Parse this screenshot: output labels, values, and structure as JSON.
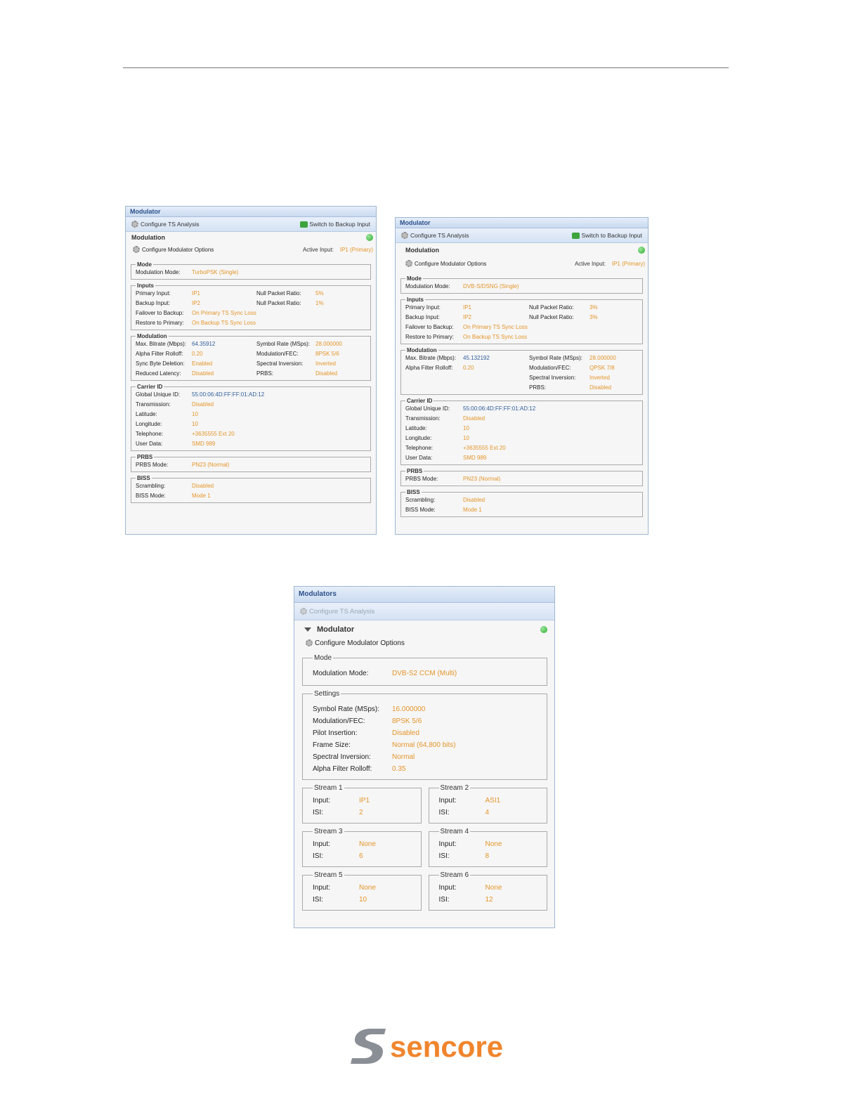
{
  "panel_single_turbo": {
    "title": "Modulator",
    "toolbar_left": "Configure TS Analysis",
    "toolbar_right": "Switch to Backup Input",
    "section": "Modulation",
    "config_options": "Configure Modulator Options",
    "active_input_label": "Active Input:",
    "active_input_value": "IP1 (Primary)",
    "mode_legend": "Mode",
    "mode_label": "Modulation Mode:",
    "mode_value": "TurboPSK (Single)",
    "inputs_legend": "Inputs",
    "primary_input_label": "Primary Input:",
    "primary_input_value": "IP1",
    "null1_label": "Null Packet Ratio:",
    "null1_value": "5%",
    "backup_input_label": "Backup Input:",
    "backup_input_value": "IP2",
    "null2_label": "Null Packet Ratio:",
    "null2_value": "1%",
    "failover_label": "Failover to Backup:",
    "failover_value": "On Primary TS Sync Loss",
    "restore_label": "Restore to Primary:",
    "restore_value": "On Backup TS Sync Loss",
    "modulation_legend": "Modulation",
    "max_bitrate_label": "Max. Bitrate (Mbps):",
    "max_bitrate_value": "64.35912",
    "symbol_rate_label": "Symbol Rate (MSps):",
    "symbol_rate_value": "28.000000",
    "alpha_label": "Alpha Filter Rolloff:",
    "alpha_value": "0.20",
    "modfec_label": "Modulation/FEC:",
    "modfec_value": "8PSK 5/6",
    "sync_label": "Sync Byte Deletion:",
    "sync_value": "Enabled",
    "spectral_label": "Spectral Inversion:",
    "spectral_value": "Inverted",
    "latency_label": "Reduced Latency:",
    "latency_value": "Disabled",
    "prbs_label": "PRBS:",
    "prbs_value": "Disabled",
    "carrier_legend": "Carrier ID",
    "guid_label": "Global Unique ID:",
    "guid_value": "55:00:06:4D:FF:FF:01:AD:12",
    "transmission_label": "Transmission:",
    "transmission_value": "Disabled",
    "latitude_label": "Latitude:",
    "latitude_value": "10",
    "longitude_label": "Longitude:",
    "longitude_value": "10",
    "telephone_label": "Telephone:",
    "telephone_value": "+3635555 Ext 20",
    "userdata_label": "User Data:",
    "userdata_value": "SMD 989",
    "prbs_legend": "PRBS",
    "prbs_mode_label": "PRBS Mode:",
    "prbs_mode_value": "PN23 (Normal)",
    "biss_legend": "BISS",
    "scrambling_label": "Scrambling:",
    "scrambling_value": "Disabled",
    "biss_mode_label": "BISS Mode:",
    "biss_mode_value": "Mode 1"
  },
  "panel_single_dvbs": {
    "title": "Modulator",
    "toolbar_left": "Configure TS Analysis",
    "toolbar_right": "Switch to Backup Input",
    "section": "Modulation",
    "config_options": "Configure Modulator Options",
    "active_input_label": "Active Input:",
    "active_input_value": "IP1 (Primary)",
    "mode_legend": "Mode",
    "mode_label": "Modulation Mode:",
    "mode_value": "DVB-S/DSNG (Single)",
    "inputs_legend": "Inputs",
    "primary_input_label": "Primary Input:",
    "primary_input_value": "IP1",
    "null1_label": "Null Packet Ratio:",
    "null1_value": "3%",
    "backup_input_label": "Backup Input:",
    "backup_input_value": "IP2",
    "null2_label": "Null Packet Ratio:",
    "null2_value": "3%",
    "failover_label": "Failover to Backup:",
    "failover_value": "On Primary TS Sync Loss",
    "restore_label": "Restore to Primary:",
    "restore_value": "On Backup TS Sync Loss",
    "modulation_legend": "Modulation",
    "max_bitrate_label": "Max. Bitrate (Mbps):",
    "max_bitrate_value": "45.132192",
    "symbol_rate_label": "Symbol Rate (MSps):",
    "symbol_rate_value": "28.000000",
    "alpha_label": "Alpha Filter Rolloff:",
    "alpha_value": "0.20",
    "modfec_label": "Modulation/FEC:",
    "modfec_value": "QPSK 7/8",
    "spectral_label": "Spectral Inversion:",
    "spectral_value": "Inverted",
    "prbs_label": "PRBS:",
    "prbs_value": "Disabled",
    "carrier_legend": "Carrier ID",
    "guid_label": "Global Unique ID:",
    "guid_value": "55:00:06:4D:FF:FF:01:AD:12",
    "transmission_label": "Transmission:",
    "transmission_value": "Disabled",
    "latitude_label": "Latitude:",
    "latitude_value": "10",
    "longitude_label": "Longitude:",
    "longitude_value": "10",
    "telephone_label": "Telephone:",
    "telephone_value": "+3635555 Ext 20",
    "userdata_label": "User Data:",
    "userdata_value": "SMD 989",
    "prbs_legend": "PRBS",
    "prbs_mode_label": "PRBS Mode:",
    "prbs_mode_value": "PN23 (Normal)",
    "biss_legend": "BISS",
    "scrambling_label": "Scrambling:",
    "scrambling_value": "Disabled",
    "biss_mode_label": "BISS Mode:",
    "biss_mode_value": "Mode 1"
  },
  "panel_multi": {
    "title": "Modulators",
    "toolbar_left": "Configure TS Analysis",
    "section": "Modulator",
    "config_options": "Configure Modulator Options",
    "mode_legend": "Mode",
    "mode_label": "Modulation Mode:",
    "mode_value": "DVB-S2 CCM (Multi)",
    "settings_legend": "Settings",
    "symbol_rate_label": "Symbol Rate (MSps):",
    "symbol_rate_value": "16.000000",
    "modfec_label": "Modulation/FEC:",
    "modfec_value": "8PSK 5/6",
    "pilot_label": "Pilot Insertion:",
    "pilot_value": "Disabled",
    "frame_label": "Frame Size:",
    "frame_value": "Normal (64,800 bits)",
    "spectral_label": "Spectral Inversion:",
    "spectral_value": "Normal",
    "alpha_label": "Alpha Filter Rolloff:",
    "alpha_value": "0.35",
    "input_label": "Input:",
    "isi_label": "ISI:",
    "streams": [
      {
        "legend": "Stream 1",
        "input": "IP1",
        "isi": "2"
      },
      {
        "legend": "Stream 2",
        "input": "ASI1",
        "isi": "4"
      },
      {
        "legend": "Stream 3",
        "input": "None",
        "isi": "6"
      },
      {
        "legend": "Stream 4",
        "input": "None",
        "isi": "8"
      },
      {
        "legend": "Stream 5",
        "input": "None",
        "isi": "10"
      },
      {
        "legend": "Stream 6",
        "input": "None",
        "isi": "12"
      }
    ]
  },
  "logo": {
    "text": "sencore",
    "color": "#f0852d",
    "mark_color": "#8a8f96"
  }
}
